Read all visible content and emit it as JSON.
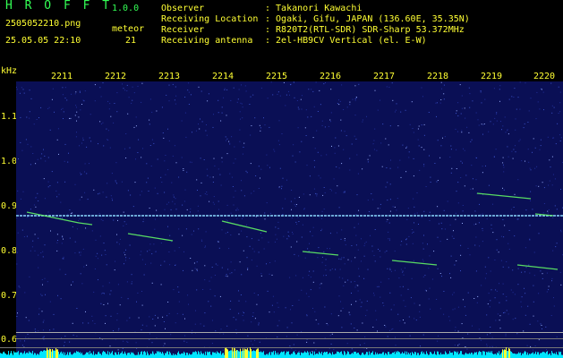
{
  "header": {
    "logo_text": "H R O F F T",
    "version": "1.0.0",
    "filename": "2505052210.png",
    "timestamp": "25.05.05 22:10",
    "meteor_label": "meteor",
    "meteor_count": "21",
    "info": [
      {
        "label": "Observer",
        "value": ": Takanori Kawachi"
      },
      {
        "label": "Receiving Location",
        "value": ": Ogaki, Gifu, JAPAN (136.60E, 35.35N)"
      },
      {
        "label": "Receiver",
        "value": ": R820T2(RTL-SDR) SDR-Sharp 53.372MHz"
      },
      {
        "label": "Receiving antenna",
        "value": ": 2el-HB9CV Vertical (el. E-W)"
      }
    ]
  },
  "axis": {
    "y_unit": "kHz",
    "x_ticks": [
      "2211",
      "2212",
      "2213",
      "2214",
      "2215",
      "2216",
      "2217",
      "2218",
      "2219",
      "2220"
    ],
    "y_ticks": [
      "1.1",
      "1.0",
      "0.9",
      "0.8",
      "0.7",
      "0.6"
    ]
  },
  "colors": {
    "background": "#0a0f55",
    "header_green": "#33ff55",
    "header_yellow": "#ffff33",
    "carrier": "#8ad8ff",
    "meteor_trail": "#66ff66",
    "spectrum": "#00e5ff"
  }
}
